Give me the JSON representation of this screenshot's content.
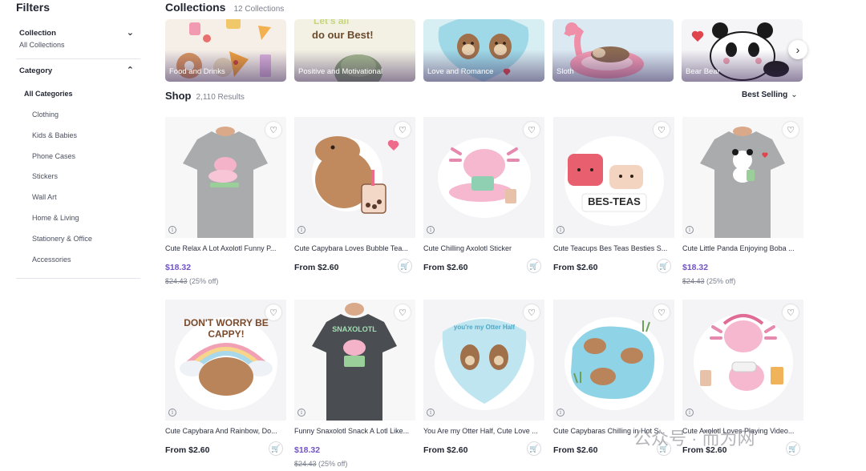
{
  "sidebar": {
    "title": "Filters",
    "collection": {
      "label": "Collection",
      "value": "All Collections",
      "chevron": "chevron-down-icon"
    },
    "category": {
      "label": "Category",
      "chevron": "chevron-up-icon",
      "all": "All Categories",
      "items": [
        "Clothing",
        "Kids & Babies",
        "Phone Cases",
        "Stickers",
        "Wall Art",
        "Home & Living",
        "Stationery & Office",
        "Accessories"
      ]
    }
  },
  "collections": {
    "title": "Collections",
    "count": "12 Collections",
    "cards": [
      {
        "label": "Food and Drinks"
      },
      {
        "label": "Positive and Motivational",
        "art_text": "do our Best!"
      },
      {
        "label": "Love and Romance"
      },
      {
        "label": "Sloth"
      },
      {
        "label": "Bear Bear"
      }
    ],
    "next_icon": "chevron-right-icon"
  },
  "shop": {
    "title": "Shop",
    "count": "2,110 Results",
    "sort": "Best Selling"
  },
  "products": [
    {
      "title": "Cute Relax A Lot Axolotl Funny P...",
      "price": "$18.32",
      "old_price": "$24.43",
      "discount": "(25% off)",
      "sale": true,
      "cart": false
    },
    {
      "title": "Cute Capybara Loves Bubble Tea...",
      "price": "From $2.60",
      "sale": false,
      "cart": true
    },
    {
      "title": "Cute Chilling Axolotl Sticker",
      "price": "From $2.60",
      "sale": false,
      "cart": true
    },
    {
      "title": "Cute Teacups Bes Teas Besties S...",
      "price": "From $2.60",
      "sale": false,
      "cart": true,
      "art_text": "BES-TEAS"
    },
    {
      "title": "Cute Little Panda Enjoying Boba ...",
      "price": "$18.32",
      "old_price": "$24.43",
      "discount": "(25% off)",
      "sale": true,
      "cart": false
    },
    {
      "title": "Cute Capybara And Rainbow, Do...",
      "price": "From $2.60",
      "sale": false,
      "cart": true,
      "art_text": "DON'T WORRY BE CAPPY!"
    },
    {
      "title": "Funny Snaxolotl Snack A Lotl Like...",
      "price": "$18.32",
      "old_price": "$24.43",
      "discount": "(25% off)",
      "sale": true,
      "cart": false,
      "art_text": "SNAXOLOTL"
    },
    {
      "title": "You Are my Otter Half, Cute Love ...",
      "price": "From $2.60",
      "sale": false,
      "cart": true,
      "art_text": "you're my Otter Half"
    },
    {
      "title": "Cute Capybaras Chilling in Hot S...",
      "price": "From $2.60",
      "sale": false,
      "cart": true
    },
    {
      "title": "Cute Axolotl Loves Playing Video...",
      "price": "From $2.60",
      "sale": false,
      "cart": true
    }
  ],
  "icons": {
    "favorite": "heart-icon",
    "cart": "cart-icon",
    "info": "info-icon"
  },
  "watermark": "公众号 · 而为网",
  "colors": {
    "sale_price": "#7154c8",
    "text": "#1f2430"
  }
}
